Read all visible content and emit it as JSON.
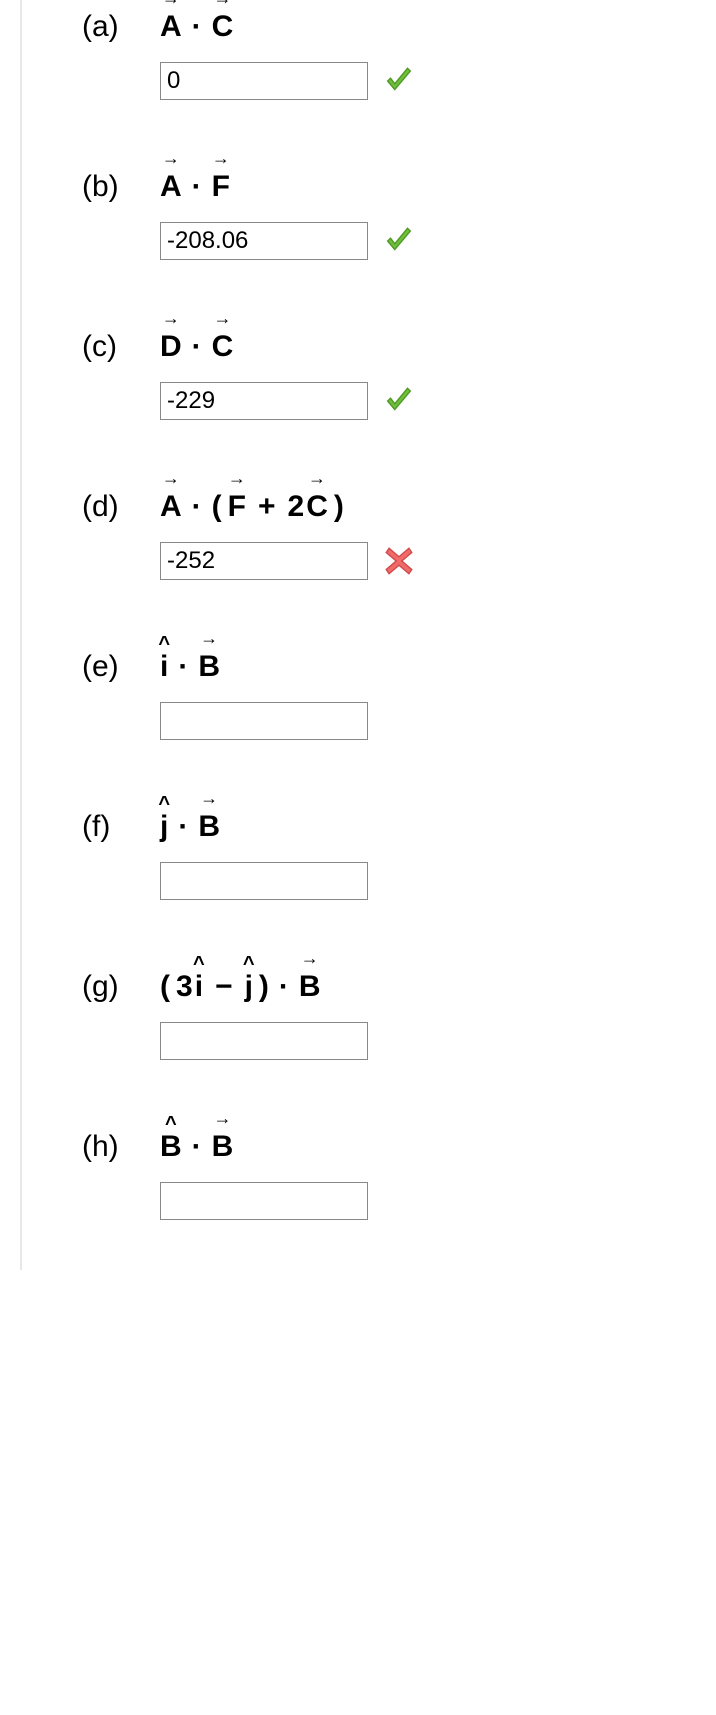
{
  "questions": [
    {
      "label": "(a)",
      "value": "0",
      "status": "correct"
    },
    {
      "label": "(b)",
      "value": "-208.06",
      "status": "correct"
    },
    {
      "label": "(c)",
      "value": "-229",
      "status": "correct"
    },
    {
      "label": "(d)",
      "value": "-252",
      "status": "incorrect"
    },
    {
      "label": "(e)",
      "value": "",
      "status": "none"
    },
    {
      "label": "(f)",
      "value": "",
      "status": "none"
    },
    {
      "label": "(g)",
      "value": "",
      "status": "none"
    },
    {
      "label": "(h)",
      "value": "",
      "status": "none"
    }
  ],
  "expr": {
    "A": "A",
    "B": "B",
    "C": "C",
    "D": "D",
    "F": "F",
    "i": "i",
    "j": "j",
    "two": "2",
    "three": "3",
    "plus": "+",
    "minus": "−",
    "dot": "·",
    "lparen": "(",
    "rparen": ")"
  }
}
